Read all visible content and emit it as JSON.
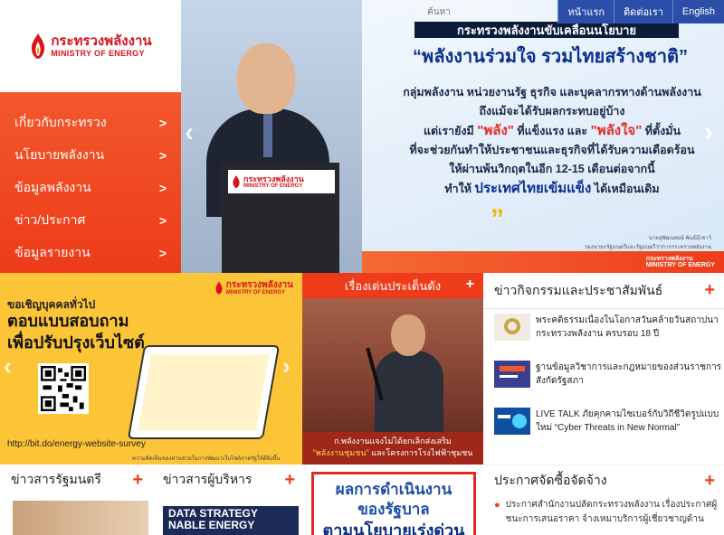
{
  "logo": {
    "name_th": "กระทรวงพลังงาน",
    "name_en": "MINISTRY OF ENERGY"
  },
  "colors": {
    "brand_red": "#ee3c1b",
    "nav_blue": "#2b4fa8",
    "survey_yellow": "#fcc437"
  },
  "nav": {
    "items": [
      {
        "label": "เกี่ยวกับกระทรวง",
        "arrow": ">"
      },
      {
        "label": "นโยบายพลังงาน",
        "arrow": ">"
      },
      {
        "label": "ข้อมูลพลังงาน",
        "arrow": ">"
      },
      {
        "label": "ข่าว/ประกาศ",
        "arrow": ">"
      },
      {
        "label": "ข้อมูลรายงาน",
        "arrow": ">"
      }
    ]
  },
  "topbar": {
    "search_placeholder": "ค้นหา",
    "home": "หน้าแรก",
    "contact": "ติดต่อเรา",
    "english": "English"
  },
  "hero": {
    "title": "กระทรวงพลังงานขับเคลื่อนนโยบาย",
    "slogan": "“พลังงานร่วมใจ รวมไทยสร้างชาติ”",
    "line1": "กลุ่มพลังงาน หน่วยงานรัฐ ธุรกิจ และบุคลากรทางด้านพลังงาน",
    "line2": "ถึงแม้จะได้รับผลกระทบอยู่บ้าง",
    "line3_a": "แต่เรายังมี ",
    "line3_b": "\"พลัง\"",
    "line3_c": " ที่แข็งแรง และ ",
    "line3_d": "\"พลังใจ\"",
    "line3_e": " ที่ตั้งมั่น",
    "line4": "ที่จะช่วยกันทำให้ประชาชนและธุรกิจที่ได้รับความเดือดร้อน",
    "line5": "ให้ผ่านพ้นวิกฤตในอีก 12-15 เดือนต่อจากนี้",
    "line6_a": "ทำให้ ",
    "line6_b": "ประเทศไทยเข้มแข็ง",
    "line6_c": " ได้เหมือนเดิม",
    "quote_close": "”",
    "signer_name": "นายสุพัฒนพงษ์ พันธ์มีเชาว์",
    "signer_title": "รองนายกรัฐมนตรีและรัฐมนตรีว่าการกระทรวงพลังงาน",
    "prev": "‹",
    "next": "›"
  },
  "survey": {
    "line1": "ขอเชิญบุคคลทั่วไป",
    "line2": "ตอบแบบสอบถาม",
    "line3": "เพื่อปรับปรุงเว็บไซต์",
    "url": "http://bit.do/energy-website-survey",
    "footer": "ความคิดเห็นของท่านช่วยในการพัฒนาเว็บไซต์ภาครัฐให้ดียิ่งขึ้น",
    "prev": "‹",
    "next": "›"
  },
  "highlight": {
    "title": "เรื่องเด่นประเด็นดัง",
    "plus": "+",
    "caption1": "ก.พลังงานแจงไม่ได้ยกเลิกส่งเสริม",
    "caption2": "\"พลังงานชุมชน\"",
    "caption3": " และโครงการโรงไฟฟ้าชุมชน"
  },
  "activities": {
    "title": "ข่าวกิจกรรมและประชาสัมพันธ์",
    "plus": "+",
    "items": [
      {
        "text": "พระคติธรรมเนื่องในโอกาสวันคล้ายวันสถาปนา กระทรวงพลังงาน ครบรอบ 18 ปี"
      },
      {
        "text": "ฐานข้อมูลวิชาการและกฎหมายของส่วนราชการ สังกัดรัฐสภา"
      },
      {
        "text": "LIVE TALK ภัยคุกคามไซเบอร์กับวิถีชีวิตรูปแบบใหม่ “Cyber Threats in New Normal”"
      }
    ]
  },
  "cabinet": {
    "title": "ข่าวสารรัฐมนตรี",
    "plus": "+"
  },
  "exec": {
    "title": "ข่าวสารผู้บริหาร",
    "plus": "+",
    "img_text": "DATA STRATEGY NABLE ENERGY"
  },
  "govwork": {
    "line1": "ผลการดำเนินงาน",
    "line2": "ของรัฐบาล",
    "line3": "ตามนโยบายเร่งด่วน"
  },
  "procure": {
    "title": "ประกาศจัดซื้อจัดจ้าง",
    "plus": "+",
    "item": "ประกาศสำนักงานปลัดกระทรวงพลังงาน เรื่องประกาศผู้ชนะการเสนอราคา จ้างเหมาบริการผู้เชี่ยวชาญด้าน"
  }
}
